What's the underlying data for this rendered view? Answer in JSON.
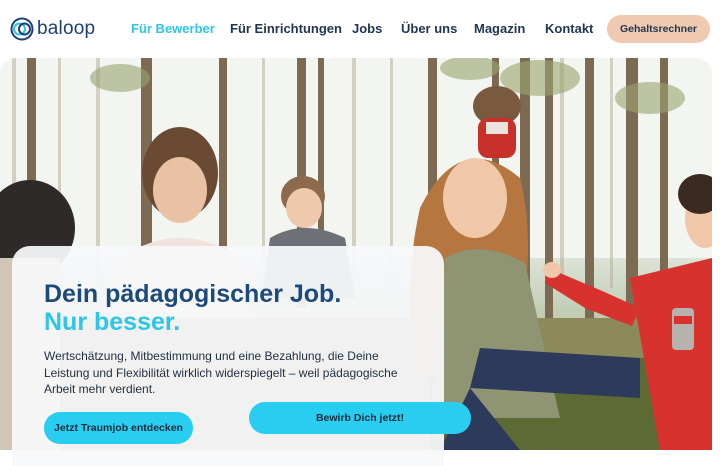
{
  "brand": {
    "name": "baloop"
  },
  "nav": {
    "items": [
      {
        "label": "Für Bewerber",
        "active": true
      },
      {
        "label": "Für Einrichtungen",
        "active": false
      },
      {
        "label": "Jobs",
        "active": false
      },
      {
        "label": "Über uns",
        "active": false
      },
      {
        "label": "Magazin",
        "active": false
      },
      {
        "label": "Kontakt",
        "active": false
      }
    ],
    "cta_label": "Gehaltsrechner"
  },
  "hero": {
    "headline_line1": "Dein pädagogischer Job.",
    "headline_line2": "Nur besser.",
    "intro": "Wertschätzung, Mitbestimmung und eine Bezahlung, die Deine Leistung und Flexibilität wirklich widerspiegelt – weil pädagogische Arbeit mehr verdient.",
    "primary_button": "Jetzt Traumjob entdecken",
    "secondary_button": "Bewirb Dich jetzt!"
  },
  "colors": {
    "accent": "#2ec6e6",
    "navy": "#1d4a7c",
    "salary_button": "#f0c9b1",
    "button_cyan": "#28cdf0"
  },
  "icons": [
    "baloop-logo-icon"
  ]
}
